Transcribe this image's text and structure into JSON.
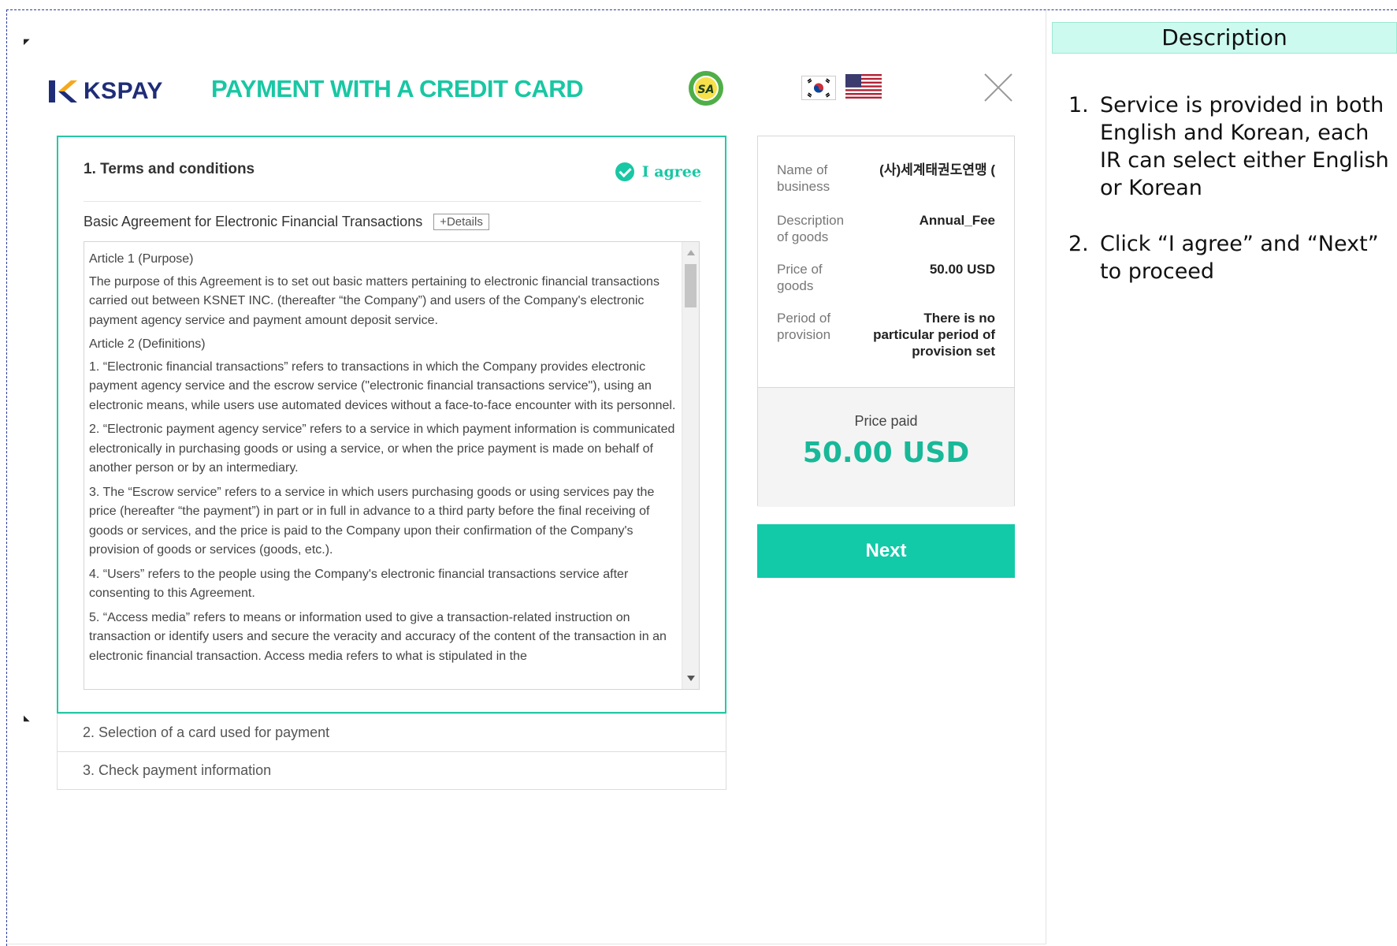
{
  "header": {
    "logo_text": "KSPAY",
    "title": "PAYMENT WITH A CREDIT CARD",
    "badge_text": "SA"
  },
  "terms": {
    "section_title": "1. Terms and conditions",
    "agree_label": "I agree",
    "basic_label": "Basic Agreement for Electronic Financial Transactions",
    "details_label": "+Details",
    "content": [
      "Article 1 (Purpose)",
      "The purpose of this Agreement is to set out basic matters pertaining to electronic financial transactions carried out between KSNET INC. (thereafter “the Company”) and users of the Company's electronic payment agency service and payment amount deposit service.",
      "Article 2 (Definitions)",
      "1. “Electronic financial transactions” refers to transactions in which the Company provides electronic payment agency service and the escrow service (\"electronic financial transactions service\"), using an electronic means, while users use automated devices without a face-to-face encounter with its personnel.",
      "2. “Electronic payment agency service” refers to a service in which payment information is communicated electronically in purchasing goods or using a service, or when the price payment is made on behalf of another person or by an intermediary.",
      "3. The “Escrow service” refers to a service in which users purchasing goods or using services pay the price (hereafter “the payment”) in part or in full in advance to a third party before the final receiving of goods or services, and the price is paid to the Company upon their confirmation of the Company's provision of goods or services (goods, etc.).",
      "4. “Users” refers to the people using the Company's electronic financial transactions service after consenting to this Agreement.",
      "5. “Access media” refers to means or information used to give a transaction-related instruction on transaction or identify users and secure the veracity and accuracy of the content of the transaction in an electronic financial transaction. Access media refers to what is stipulated in the"
    ]
  },
  "accordion": {
    "step2": "2. Selection of a card used for payment",
    "step3": "3. Check payment information"
  },
  "summary": {
    "rows": [
      {
        "label": "Name of business",
        "value": "(사)세계태권도연맹 ("
      },
      {
        "label": "Description of goods",
        "value": "Annual_Fee"
      },
      {
        "label": "Price of goods",
        "value": "50.00 USD"
      },
      {
        "label": "Period of provision",
        "value": "There is no particular period of provision set"
      }
    ],
    "price_label": "Price paid",
    "price_amount": "50.00 USD"
  },
  "next_label": "Next",
  "description": {
    "header": "Description",
    "items": [
      "Service is provided in both English and Korean, each IR can select either English or Korean",
      "Click “I agree” and “Next” to proceed"
    ]
  },
  "colors": {
    "accent": "#18c7a3",
    "brand_navy": "#1f2d78",
    "frame_dash": "#2b3a9a",
    "desc_header_bg": "#ccfaef"
  },
  "icons": [
    "kspay-logo-icon",
    "sa-badge-icon",
    "korea-flag-icon",
    "us-flag-icon",
    "close-icon",
    "check-circle-icon",
    "scroll-up-icon",
    "scroll-down-icon"
  ]
}
